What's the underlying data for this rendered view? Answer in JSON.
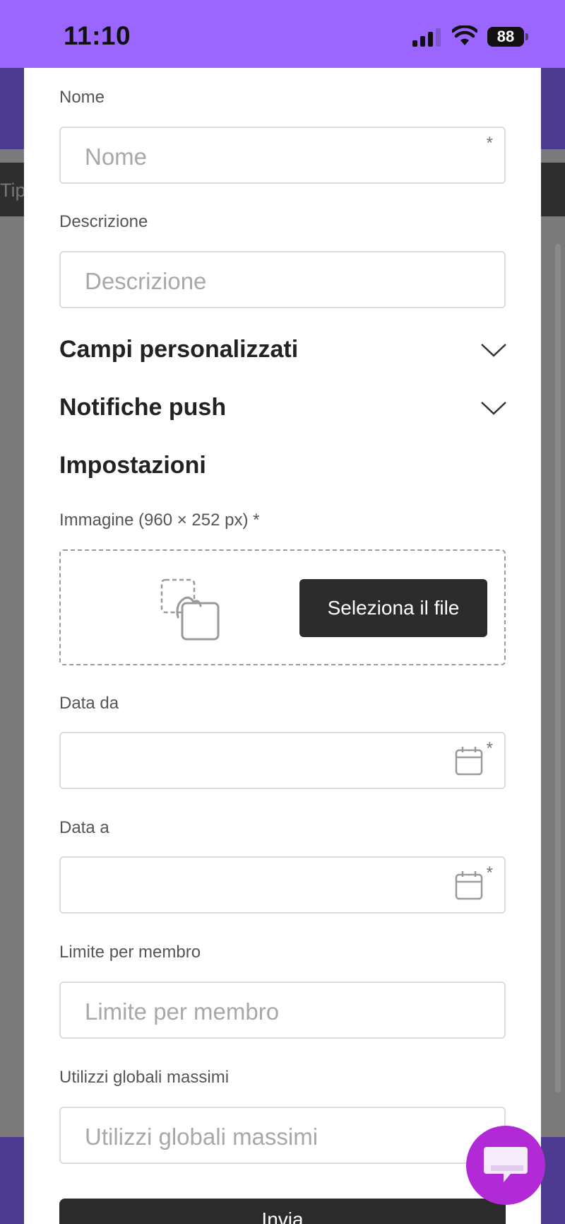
{
  "status_bar": {
    "time": "11:10",
    "battery": "88"
  },
  "background": {
    "tab_fragment": "Tipo"
  },
  "form": {
    "name": {
      "label": "Nome",
      "placeholder": "Nome",
      "required": "*"
    },
    "description": {
      "label": "Descrizione",
      "placeholder": "Descrizione"
    },
    "custom_fields": {
      "title": "Campi personalizzati"
    },
    "push_notifications": {
      "title": "Notifiche push"
    },
    "settings": {
      "title": "Impostazioni"
    },
    "image": {
      "label": "Immagine (960 × 252 px) *",
      "button": "Seleziona il file"
    },
    "date_from": {
      "label": "Data da",
      "required": "*"
    },
    "date_to": {
      "label": "Data a",
      "required": "*"
    },
    "limit_per_member": {
      "label": "Limite per membro",
      "placeholder": "Limite per membro"
    },
    "max_global_uses": {
      "label": "Utilizzi globali massimi",
      "placeholder": "Utilizzi globali massimi"
    },
    "submit_label": "Invia"
  },
  "icons": {
    "signal": "cellular-signal-icon",
    "wifi": "wifi-icon",
    "chevron": "chevron-down-icon",
    "calendar": "calendar-icon",
    "image_drop": "image-upload-icon",
    "chat": "chat-icon"
  },
  "colors": {
    "status_bar": "#9b66ff",
    "header_bg": "#4b3a8f",
    "button_dark": "#2b2b2b",
    "chat_fab": "#b12ad6"
  }
}
